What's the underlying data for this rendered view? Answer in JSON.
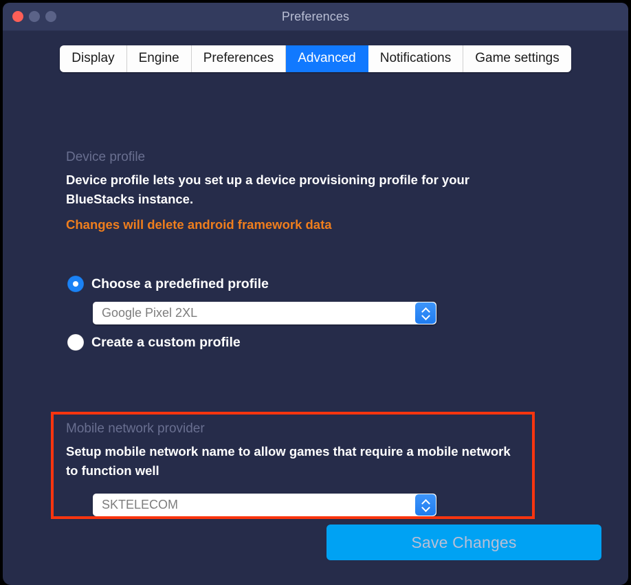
{
  "window": {
    "title": "Preferences",
    "traffic_lights": [
      "close-button",
      "minimize-button",
      "maximize-button"
    ],
    "colors": {
      "body_bg": "#262c4a",
      "titlebar_bg": "#333b5e",
      "accent_blue": "#1179ff",
      "save_blue": "#00a2f3",
      "warning_orange": "#ef7e1d",
      "highlight_red": "#f9350f",
      "heading_muted": "#696f90"
    }
  },
  "tabs": [
    {
      "label": "Display",
      "active": false
    },
    {
      "label": "Engine",
      "active": false
    },
    {
      "label": "Preferences",
      "active": false
    },
    {
      "label": "Advanced",
      "active": true
    },
    {
      "label": "Notifications",
      "active": false
    },
    {
      "label": "Game settings",
      "active": false
    }
  ],
  "device_profile": {
    "heading": "Device profile",
    "description": "Device profile lets you set up a device provisioning profile for your BlueStacks instance.",
    "warning": "Changes will delete android framework data",
    "option_predefined": "Choose a predefined profile",
    "option_custom": "Create a custom profile",
    "selected_option": "predefined",
    "profile_select": {
      "value": "Google Pixel 2XL"
    }
  },
  "mobile_network": {
    "heading": "Mobile network provider",
    "description": "Setup mobile network name to allow games that require a mobile network to function well",
    "provider_select": {
      "value": "SKTELECOM"
    },
    "highlighted": true
  },
  "actions": {
    "save_label": "Save Changes"
  }
}
